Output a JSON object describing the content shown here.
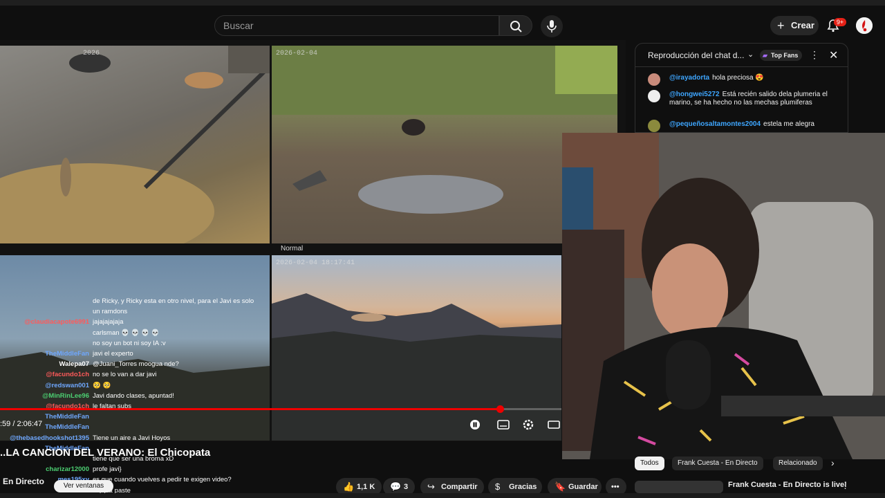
{
  "header": {
    "search_placeholder": "Buscar",
    "create_label": "Crear",
    "notifications_badge": "9+"
  },
  "video": {
    "camera_timestamps": [
      "2026",
      "2026-02-04",
      "2026-02-04 18:17:41"
    ],
    "player_mode": "Normal",
    "time": ":59 / 2:06:47",
    "progress_fraction": 0.89,
    "title": "..LA CANCION DEL VERANO: El Chicopata",
    "live_label": "En Directo",
    "windows_button": "Ver ventanas"
  },
  "overlay_chat": [
    {
      "user": "",
      "msg": "de Ricky, y Ricky esta en otro nivel, para el Javi es solo",
      "color": "#ddd"
    },
    {
      "user": "",
      "msg": "un ramdons",
      "color": "#ddd"
    },
    {
      "user": "@claudiacapote6991",
      "msg": "jajajajajaja",
      "color": "#ff5a5a"
    },
    {
      "user": "",
      "msg": "carlsman 💀 💀 💀 💀",
      "color": "#ffd84a"
    },
    {
      "user": "",
      "msg": "no soy un bot ni soy IA :v",
      "color": "#c58cff"
    },
    {
      "user": "TheMiddleFan",
      "msg": "javi el experto",
      "color": "#6fa8ff"
    },
    {
      "user": "Walepa07",
      "msg": "@Juani_Torres moogua nde?",
      "color": "#fff"
    },
    {
      "user": "@facundo1ch",
      "msg": "no se lo van a dar javi",
      "color": "#ff5a5a"
    },
    {
      "user": "@redswan001",
      "msg": "🥺 🥺",
      "color": "#6fa8ff"
    },
    {
      "user": "@MinRinLee96",
      "msg": "Javi dando clases, apuntad!",
      "color": "#4ccf72"
    },
    {
      "user": "@facundo1ch",
      "msg": "le faltan subs",
      "color": "#ff5a5a"
    },
    {
      "user": "TheMiddleFan",
      "msg": "",
      "color": "#6fa8ff"
    },
    {
      "user": "TheMiddleFan",
      "msg": "",
      "color": "#6fa8ff"
    },
    {
      "user": "@thebasedhookshot1395",
      "msg": "Tiene un aire a Javi Hoyos",
      "color": "#6fa8ff"
    },
    {
      "user": "TheMiddleFan",
      "msg": "",
      "color": "#6fa8ff"
    },
    {
      "user": "",
      "msg": "tiene que ser una broma xD",
      "color": "#ff5a5a"
    },
    {
      "user": "charizar12000",
      "msg": "profe javi}",
      "color": "#4ccf72"
    },
    {
      "user": "mes195xy",
      "msg": "es que cuando vuelves a pedir te exigen video?",
      "color": "#6fa8ff"
    },
    {
      "user": "",
      "msg": "copy & paste",
      "color": "#ddd"
    }
  ],
  "actions": {
    "likes": "1,1 K",
    "comments": "3",
    "share": "Compartir",
    "thanks": "Gracias",
    "save": "Guardar"
  },
  "chat_panel": {
    "title": "Reproducción del chat d...",
    "top_fans": "Top Fans",
    "messages": [
      {
        "user": "@irayadorta",
        "text": "hola preciosa 😍"
      },
      {
        "user": "@hongwei5272",
        "text": "Está recién salido dela plumeria el marino, se ha hecho no las mechas plumiferas"
      },
      {
        "user": "@pequeñosaltamontes2004",
        "text": "estela me alegra"
      }
    ]
  },
  "tabs": [
    "Todos",
    "Frank Cuesta - En Directo",
    "Relacionado"
  ],
  "recommended": {
    "title": "Frank Cuesta - En Directo is live!"
  },
  "colors": {
    "accent": "#ff0000",
    "link": "#3ea6ff",
    "background": "#0f0f0f"
  }
}
